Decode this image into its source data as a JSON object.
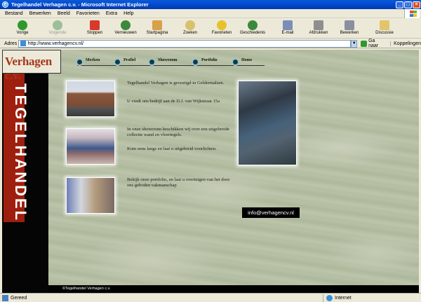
{
  "window": {
    "title": "Tegelhandel Verhagen c.v. - Microsoft Internet Explorer",
    "min": "_",
    "max": "□",
    "close": "×"
  },
  "menu": [
    "Bestand",
    "Bewerken",
    "Beeld",
    "Favorieten",
    "Extra",
    "Help"
  ],
  "toolbar": [
    {
      "label": "Vorige",
      "icon": "back-arrow-icon",
      "color": "#2e9a2e"
    },
    {
      "label": "Volgende",
      "icon": "forward-arrow-icon",
      "color": "#9bbf9b"
    },
    {
      "label": "Stoppen",
      "icon": "stop-icon",
      "color": "#d83a2a"
    },
    {
      "label": "Vernieuwen",
      "icon": "refresh-icon",
      "color": "#3b8a3b"
    },
    {
      "label": "Startpagina",
      "icon": "home-icon",
      "color": "#d9a04a"
    },
    {
      "label": "Zoeken",
      "icon": "search-icon",
      "color": "#d9c06a"
    },
    {
      "label": "Favorieten",
      "icon": "favorites-star-icon",
      "color": "#e6c22e"
    },
    {
      "label": "Geschiedenis",
      "icon": "history-icon",
      "color": "#3b8a3b"
    },
    {
      "label": "E-mail",
      "icon": "mail-icon",
      "color": "#7b8fb6"
    },
    {
      "label": "Afdrukken",
      "icon": "print-icon",
      "color": "#8e8e8e"
    },
    {
      "label": "Bewerken",
      "icon": "edit-icon",
      "color": "#8a8fa0"
    },
    {
      "label": "Discussie",
      "icon": "discussion-icon",
      "color": "#e3c46a"
    }
  ],
  "address": {
    "label": "Adres",
    "url": "http://www.verhagencv.nl/",
    "go": "Ga naar",
    "links": "Koppelingen"
  },
  "site": {
    "logo": "Verhagen c.v.",
    "vertical": "TEGELHANDEL",
    "nav": [
      "Merken",
      "Profiel",
      "Showroom",
      "Portfolio",
      "Home"
    ],
    "blocks": [
      {
        "p1": "Tegelhandel Verhagen is gevestigd in Geldermalsen.",
        "p2": "U vindt ons bedrijf aan de D.J. van Wijkstraat 15a"
      },
      {
        "p1": "In onze showroom beschikken wij over een uitgebreide collectie wand en vloertegels.",
        "p2": "Kom eens langs en laat u uitgebreid voorlichten."
      },
      {
        "p1": "Bekijk onze portfolio, en laat u overtuigen van het door ons geboden vakmanschap"
      }
    ],
    "email": "info@verhagencv.nl",
    "copyright": "©Tegelhandel Verhagen c.v."
  },
  "status": {
    "left": "Gereed",
    "zone": "Internet"
  }
}
